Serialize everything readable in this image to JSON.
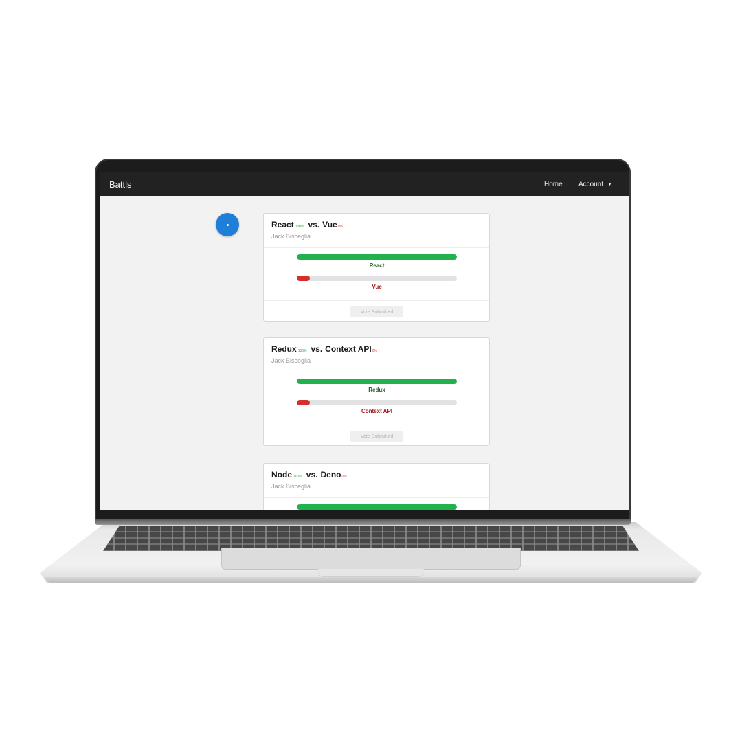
{
  "navbar": {
    "brand": "Battls",
    "links": {
      "home": "Home",
      "account": "Account"
    },
    "account_caret_icon": "caret-down-icon",
    "background": "#222222"
  },
  "fab": {
    "icon": "dot-icon",
    "color": "#1e7ed8"
  },
  "battles": [
    {
      "option_a": "React",
      "option_a_pct": "100%",
      "vs": "vs.",
      "option_b": "Vue",
      "option_b_pct": "0%",
      "author": "Jack Bisceglia",
      "bar_a_level": 1.0,
      "bar_b_level": 0.08,
      "vote_button": "Vote Submitted"
    },
    {
      "option_a": "Redux",
      "option_a_pct": "100%",
      "vs": "vs.",
      "option_b": "Context API",
      "option_b_pct": "0%",
      "author": "Jack Bisceglia",
      "bar_a_level": 1.0,
      "bar_b_level": 0.08,
      "vote_button": "Vote Submitted"
    },
    {
      "option_a": "Node",
      "option_a_pct": "100%",
      "vs": "vs.",
      "option_b": "Deno",
      "option_b_pct": "0%",
      "author": "Jack Bisceglia",
      "bar_a_level": 1.0
    }
  ],
  "colors": {
    "winner": "#22b14c",
    "loser": "#d32f2f",
    "winner_text": "#1b5e20",
    "loser_text": "#a31515"
  }
}
